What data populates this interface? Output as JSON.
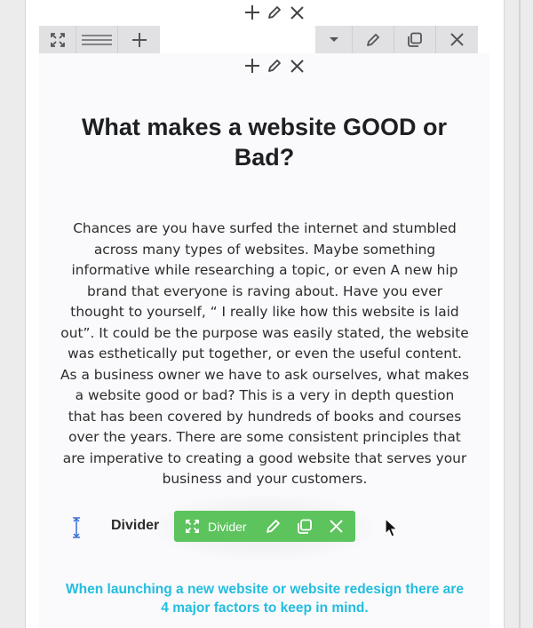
{
  "section_controls": {
    "add_icon": "plus-icon",
    "edit_icon": "pencil-icon",
    "delete_icon": "close-icon"
  },
  "row_toolbar": {
    "left": [
      "expand-icon",
      "drag-lines-icon",
      "plus-icon"
    ],
    "right": [
      "caret-down-icon",
      "pencil-icon",
      "duplicate-icon",
      "close-icon"
    ]
  },
  "content": {
    "heading": "What makes a website GOOD or Bad?",
    "paragraph": "Chances are you have surfed the internet and stumbled across many types of websites. Maybe something informative while researching a topic, or even A new hip brand that everyone is raving about. Have you ever thought to yourself, “ I really like how this website is laid out”. It could be the purpose was easily stated, the website was esthetically put together, or even the useful content. As a business owner we have to ask ourselves, what makes a website good or bad? This is a very in depth question that has been covered by hundreds of books and courses over the years. There are some consistent principles that are imperative to creating a good website that serves your business and your customers.",
    "divider_label": "Divider",
    "subheading": "When launching a new website or website redesign there are 4 major factors to keep in mind."
  },
  "widget_toolbar": {
    "label": "Divider",
    "color": "#5cc35d"
  },
  "colors": {
    "accent_text": "#22bde0",
    "toolbar_gray": "#e1e1e3",
    "resize_handle": "#3b6fd6"
  }
}
